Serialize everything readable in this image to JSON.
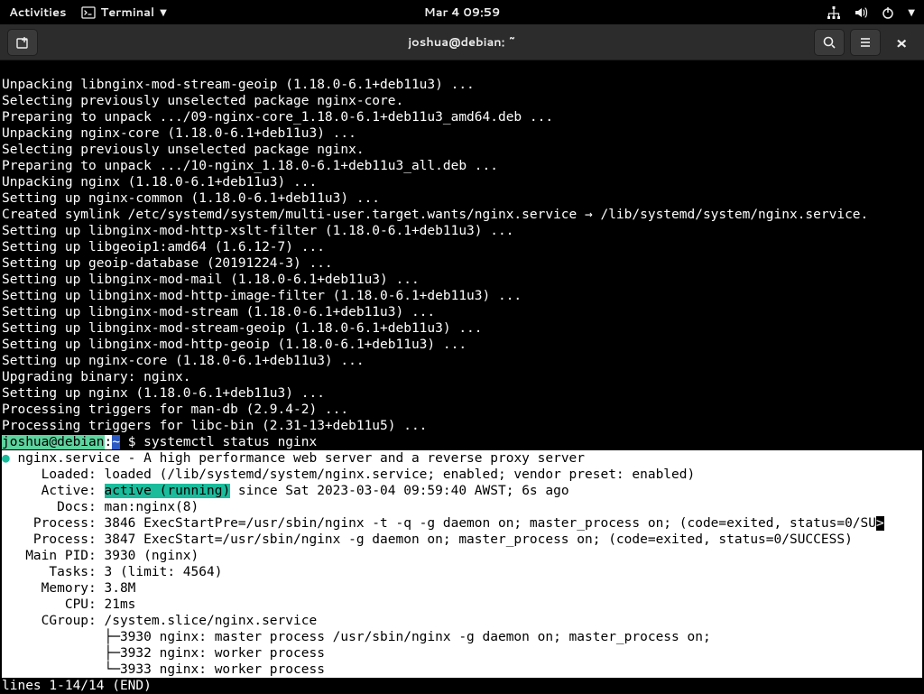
{
  "topbar": {
    "activities": "Activities",
    "app": "Terminal",
    "datetime": "Mar 4  09:59"
  },
  "titlebar": {
    "title": "joshua@debian: ~"
  },
  "terminal": {
    "pre_lines": [
      "Unpacking libnginx-mod-stream-geoip (1.18.0-6.1+deb11u3) ...",
      "Selecting previously unselected package nginx-core.",
      "Preparing to unpack .../09-nginx-core_1.18.0-6.1+deb11u3_amd64.deb ...",
      "Unpacking nginx-core (1.18.0-6.1+deb11u3) ...",
      "Selecting previously unselected package nginx.",
      "Preparing to unpack .../10-nginx_1.18.0-6.1+deb11u3_all.deb ...",
      "Unpacking nginx (1.18.0-6.1+deb11u3) ...",
      "Setting up nginx-common (1.18.0-6.1+deb11u3) ...",
      "Created symlink /etc/systemd/system/multi-user.target.wants/nginx.service → /lib/systemd/system/nginx.service.",
      "Setting up libnginx-mod-http-xslt-filter (1.18.0-6.1+deb11u3) ...",
      "Setting up libgeoip1:amd64 (1.6.12-7) ...",
      "Setting up geoip-database (20191224-3) ...",
      "Setting up libnginx-mod-mail (1.18.0-6.1+deb11u3) ...",
      "Setting up libnginx-mod-http-image-filter (1.18.0-6.1+deb11u3) ...",
      "Setting up libnginx-mod-stream (1.18.0-6.1+deb11u3) ...",
      "Setting up libnginx-mod-stream-geoip (1.18.0-6.1+deb11u3) ...",
      "Setting up libnginx-mod-http-geoip (1.18.0-6.1+deb11u3) ...",
      "Setting up nginx-core (1.18.0-6.1+deb11u3) ...",
      "Upgrading binary: nginx.",
      "Setting up nginx (1.18.0-6.1+deb11u3) ...",
      "Processing triggers for man-db (2.9.4-2) ...",
      "Processing triggers for libc-bin (2.31-13+deb11u5) ..."
    ],
    "prompt": {
      "user": "joshua@debian",
      "colon": ":",
      "path": "~",
      "symbol": "$ ",
      "command": "systemctl status nginx"
    },
    "status": {
      "header": " nginx.service - A high performance web server and a reverse proxy server",
      "loaded": "     Loaded: loaded (/lib/systemd/system/nginx.service; enabled; vendor preset: enabled)",
      "active_label": "     Active: ",
      "active_value": "active (running)",
      "active_rest": " since Sat 2023-03-04 09:59:40 AWST; 6s ago",
      "docs": "       Docs: man:nginx(8)",
      "process1": "    Process: 3846 ExecStartPre=/usr/sbin/nginx -t -q -g daemon on; master_process on; (code=exited, status=0/SU",
      "process2": "    Process: 3847 ExecStart=/usr/sbin/nginx -g daemon on; master_process on; (code=exited, status=0/SUCCESS)",
      "mainpid": "   Main PID: 3930 (nginx)",
      "tasks": "      Tasks: 3 (limit: 4564)",
      "memory": "     Memory: 3.8M",
      "cpu": "        CPU: 21ms",
      "cgroup": "     CGroup: /system.slice/nginx.service",
      "tree1": "             ├─3930 nginx: master process /usr/sbin/nginx -g daemon on; master_process on;",
      "tree2": "             ├─3932 nginx: worker process",
      "tree3": "             └─3933 nginx: worker process",
      "scroll_indicator": ">"
    },
    "pager": "lines 1-14/14 (END)"
  }
}
